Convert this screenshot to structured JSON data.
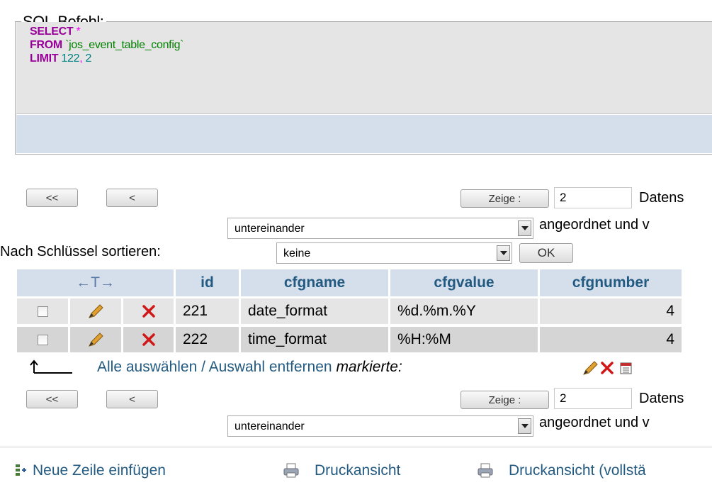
{
  "sql": {
    "legend": "SQL-Befehl:",
    "select_kw": "SELECT",
    "select_star": "*",
    "from_kw": "FROM",
    "table": "`jos_event_table_config`",
    "limit_kw": "LIMIT",
    "limit_offset": "122",
    "limit_comma": ",",
    "limit_count": "2"
  },
  "nav_top": {
    "first_label": "<<",
    "prev_label": "<",
    "show_label": "Zeige :",
    "rows_value": "2",
    "records_text": "Datens",
    "mode_value": "untereinander",
    "mode_suffix": "angeordnet und v"
  },
  "sort": {
    "label": "Nach Schlüssel sortieren:",
    "value": "keine",
    "ok_label": "OK"
  },
  "table": {
    "arrows_header": "←T→",
    "columns": [
      "id",
      "cfgname",
      "cfgvalue",
      "cfgnumber"
    ],
    "rows": [
      {
        "id": "221",
        "cfgname": "date_format",
        "cfgvalue": "%d.%m.%Y",
        "cfgnumber": "4"
      },
      {
        "id": "222",
        "cfgname": "time_format",
        "cfgvalue": "%H:%M",
        "cfgnumber": "4"
      }
    ]
  },
  "selection": {
    "select_all": "Alle auswählen",
    "separator": "/",
    "deselect": "Auswahl entfernen",
    "marked": "markierte:"
  },
  "nav_bottom": {
    "first_label": "<<",
    "prev_label": "<",
    "show_label": "Zeige :",
    "rows_value": "2",
    "records_text": "Datens",
    "mode_value": "untereinander",
    "mode_suffix": "angeordnet und v"
  },
  "actions": {
    "insert_row": "Neue Zeile einfügen",
    "print_view": "Druckansicht",
    "print_view_full": "Druckansicht (vollstä"
  }
}
